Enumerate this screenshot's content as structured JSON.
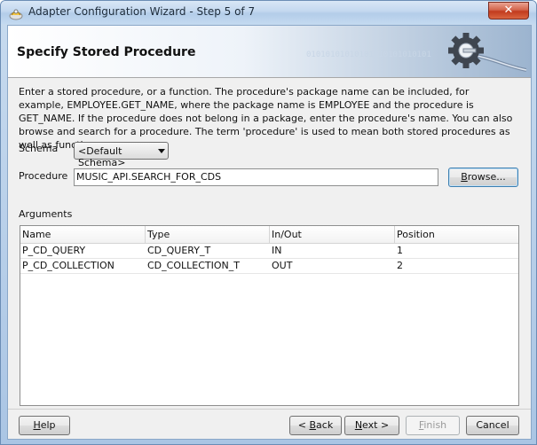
{
  "window": {
    "title": "Adapter Configuration Wizard - Step 5 of 7",
    "close_glyph": "✕"
  },
  "header": {
    "title": "Specify Stored Procedure",
    "binary_decoration": "01010101010101010101010101"
  },
  "description": "Enter a stored procedure, or a function. The procedure's package name can be included, for example, EMPLOYEE.GET_NAME, where the package name is EMPLOYEE and the procedure is GET_NAME.  If the procedure does not belong in a package, enter the procedure's name. You can also browse and search for a procedure. The term 'procedure' is used to mean both stored procedures as well as functions.",
  "schema": {
    "label": "Schema",
    "selected": "<Default Schema>"
  },
  "procedure": {
    "label": "Procedure",
    "value": "MUSIC_API.SEARCH_FOR_CDS",
    "browse_pre": "",
    "browse_mnemonic": "B",
    "browse_post": "rowse..."
  },
  "arguments": {
    "label": "Arguments",
    "columns": [
      "Name",
      "Type",
      "In/Out",
      "Position"
    ],
    "rows": [
      [
        "P_CD_QUERY",
        "CD_QUERY_T",
        "IN",
        "1"
      ],
      [
        "P_CD_COLLECTION",
        "CD_COLLECTION_T",
        "OUT",
        "2"
      ]
    ]
  },
  "footer": {
    "help": {
      "pre": "",
      "mnemonic": "H",
      "post": "elp"
    },
    "back": {
      "pre": "< ",
      "mnemonic": "B",
      "post": "ack"
    },
    "next": {
      "pre": "",
      "mnemonic": "N",
      "post": "ext >"
    },
    "finish": {
      "pre": "",
      "mnemonic": "F",
      "post": "inish"
    },
    "cancel": "Cancel"
  },
  "colors": {
    "titlebar": "#c3d8ef",
    "close_button": "#c23b1e",
    "header_gradient_end": "#9cb4cf",
    "focused_border": "#3c7fb1"
  },
  "icons": {
    "title": "adapter-app-icon",
    "header": "gear-plug-icon"
  }
}
